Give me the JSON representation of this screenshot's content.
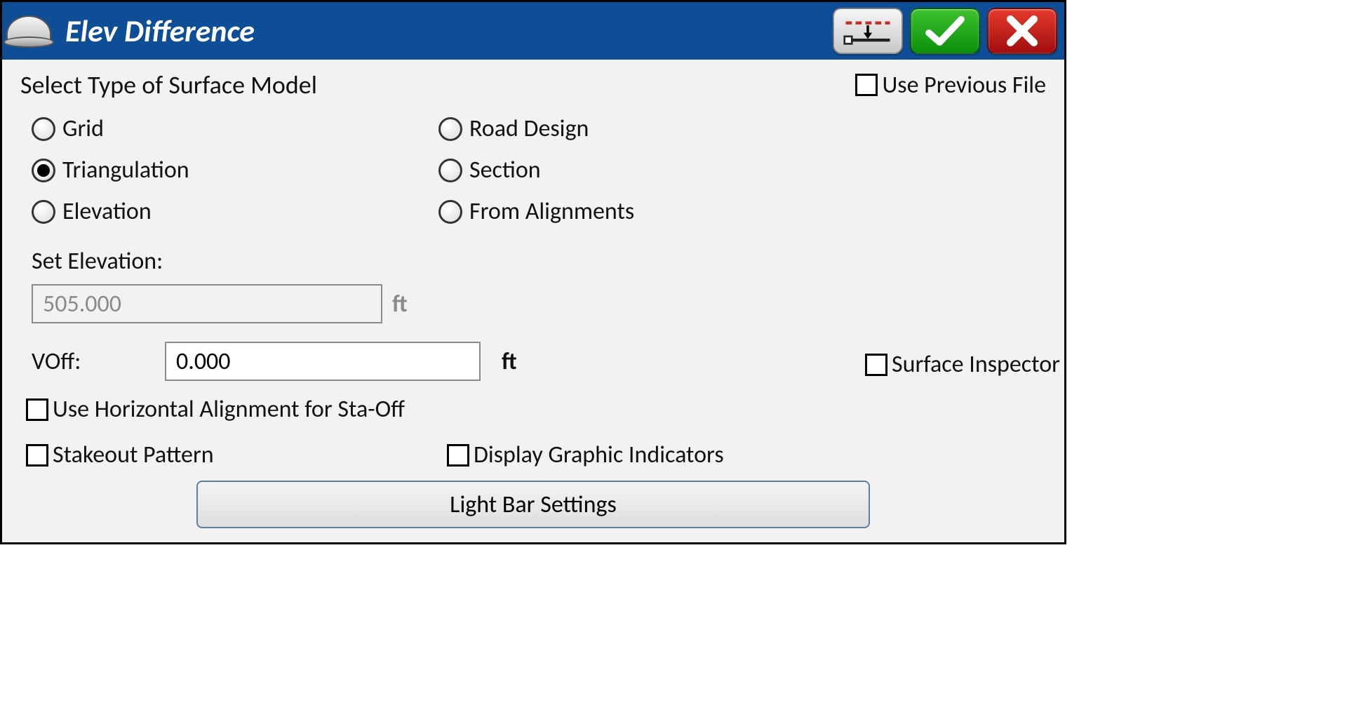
{
  "title": "Elev Difference",
  "section_label": "Select Type of Surface Model",
  "use_previous_file_label": "Use Previous File",
  "radios": {
    "grid": "Grid",
    "triangulation": "Triangulation",
    "elevation": "Elevation",
    "road_design": "Road Design",
    "section": "Section",
    "from_alignments": "From Alignments"
  },
  "selected_model": "triangulation",
  "set_elevation_label": "Set Elevation:",
  "set_elevation_value": "505.000",
  "voff_label": "VOff:",
  "voff_value": "0.000",
  "unit": "ft",
  "use_horizontal_label": "Use Horizontal Alignment for Sta-Off",
  "stakeout_pattern_label": "Stakeout Pattern",
  "display_indicators_label": "Display Graphic Indicators",
  "surface_inspector_label": "Surface Inspector",
  "light_bar_button": "Light Bar Settings"
}
